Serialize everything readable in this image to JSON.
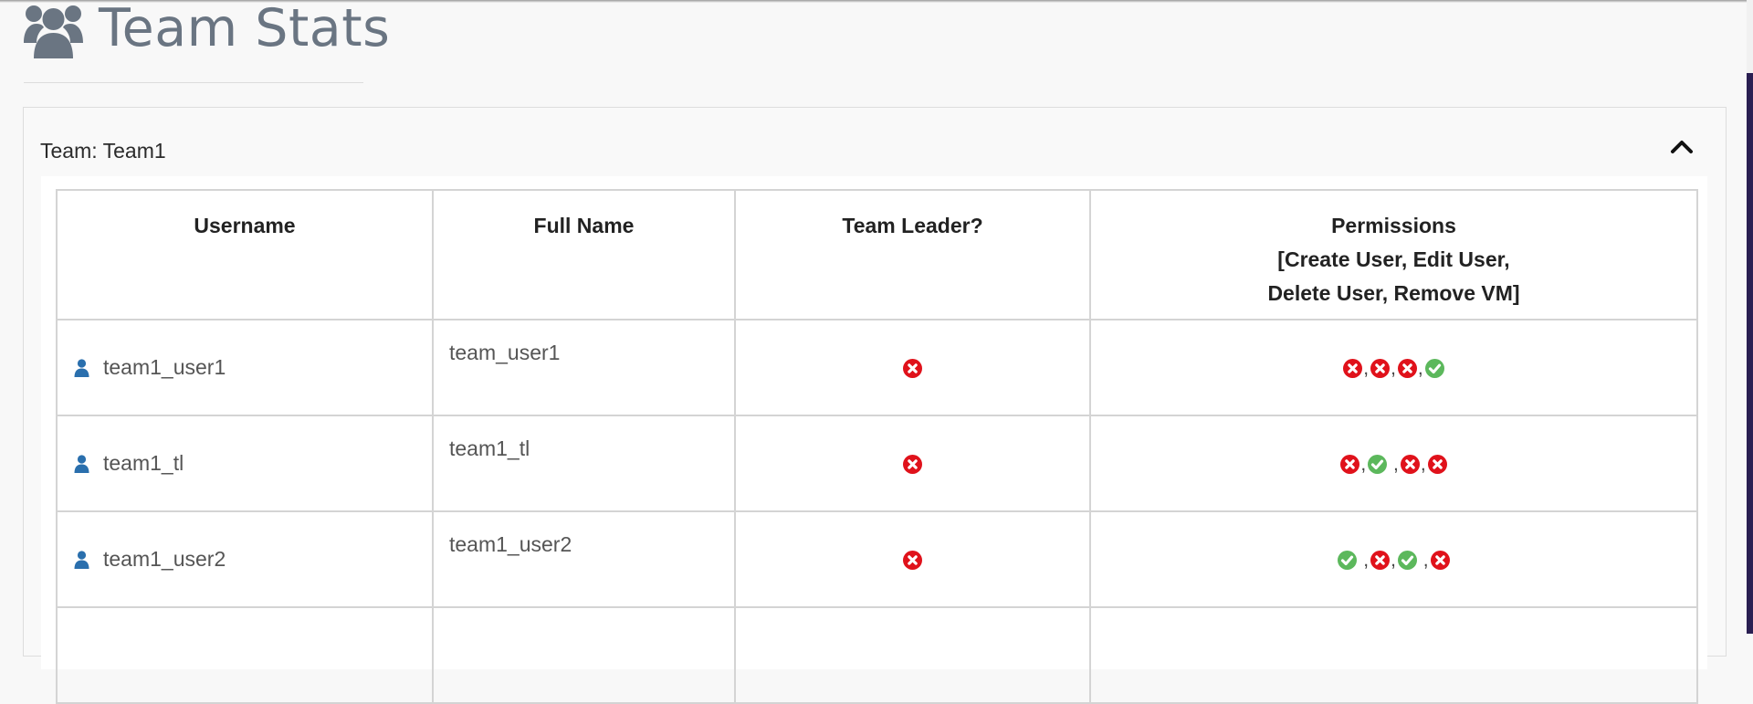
{
  "page": {
    "title": "Team Stats",
    "title_icon": "users-icon"
  },
  "panel": {
    "heading": "Team: Team1",
    "collapse_icon": "chevron-up-icon"
  },
  "table": {
    "headers": {
      "username": "Username",
      "full_name": "Full Name",
      "team_leader": "Team Leader?",
      "permissions_title": "Permissions",
      "permissions_line2": "[Create User, Edit User,",
      "permissions_line3": "Delete User, Remove VM]"
    },
    "rows": [
      {
        "username": "team1_user1",
        "full_name": "team_user1",
        "team_leader": false,
        "permissions": [
          false,
          false,
          false,
          true
        ],
        "separators": [
          ",",
          ",",
          ","
        ]
      },
      {
        "username": "team1_tl",
        "full_name": "team1_tl",
        "team_leader": false,
        "permissions": [
          false,
          true,
          false,
          false
        ],
        "separators": [
          ",",
          " ,",
          ","
        ]
      },
      {
        "username": "team1_user2",
        "full_name": "team1_user2",
        "team_leader": false,
        "permissions": [
          true,
          false,
          true,
          false
        ],
        "separators": [
          " ,",
          ",",
          " ,"
        ]
      }
    ]
  },
  "colors": {
    "yes": "#5cb85c",
    "no": "#e0121b",
    "user_icon": "#2a6fad",
    "title": "#6a7582"
  }
}
